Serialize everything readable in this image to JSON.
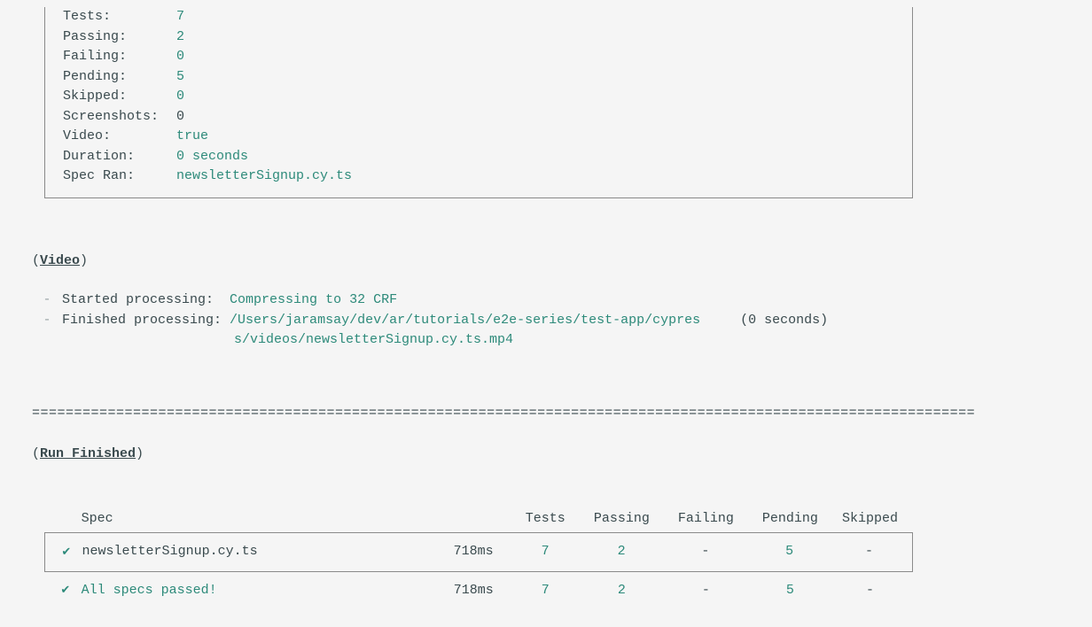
{
  "stats": {
    "tests": {
      "label": "Tests:",
      "value": "7"
    },
    "passing": {
      "label": "Passing:",
      "value": "2"
    },
    "failing": {
      "label": "Failing:",
      "value": "0"
    },
    "pending": {
      "label": "Pending:",
      "value": "5"
    },
    "skipped": {
      "label": "Skipped:",
      "value": "0"
    },
    "screenshots": {
      "label": "Screenshots:",
      "value": "0"
    },
    "video": {
      "label": "Video:",
      "value": "true"
    },
    "duration": {
      "label": "Duration:",
      "value": "0 seconds"
    },
    "spec_ran": {
      "label": "Spec Ran:",
      "value": "newsletterSignup.cy.ts"
    }
  },
  "video_section": {
    "title": "Video",
    "started_label": "Started processing:",
    "started_value": "Compressing to 32 CRF",
    "finished_label": "Finished processing:",
    "finished_value_line1": "/Users/jaramsay/dev/ar/tutorials/e2e-series/test-app/cypres",
    "finished_value_line2": "s/videos/newsletterSignup.cy.ts.mp4",
    "finished_timing": "(0 seconds)"
  },
  "divider": "================================================================================================================",
  "run_finished": {
    "title": "Run Finished"
  },
  "table": {
    "headers": {
      "spec": "Spec",
      "tests": "Tests",
      "passing": "Passing",
      "failing": "Failing",
      "pending": "Pending",
      "skipped": "Skipped"
    },
    "row": {
      "check": "✔",
      "spec": "newsletterSignup.cy.ts",
      "duration": "718ms",
      "tests": "7",
      "passing": "2",
      "failing": "-",
      "pending": "5",
      "skipped": "-"
    },
    "summary": {
      "check": "✔",
      "spec": "All specs passed!",
      "duration": "718ms",
      "tests": "7",
      "passing": "2",
      "failing": "-",
      "pending": "5",
      "skipped": "-"
    }
  }
}
